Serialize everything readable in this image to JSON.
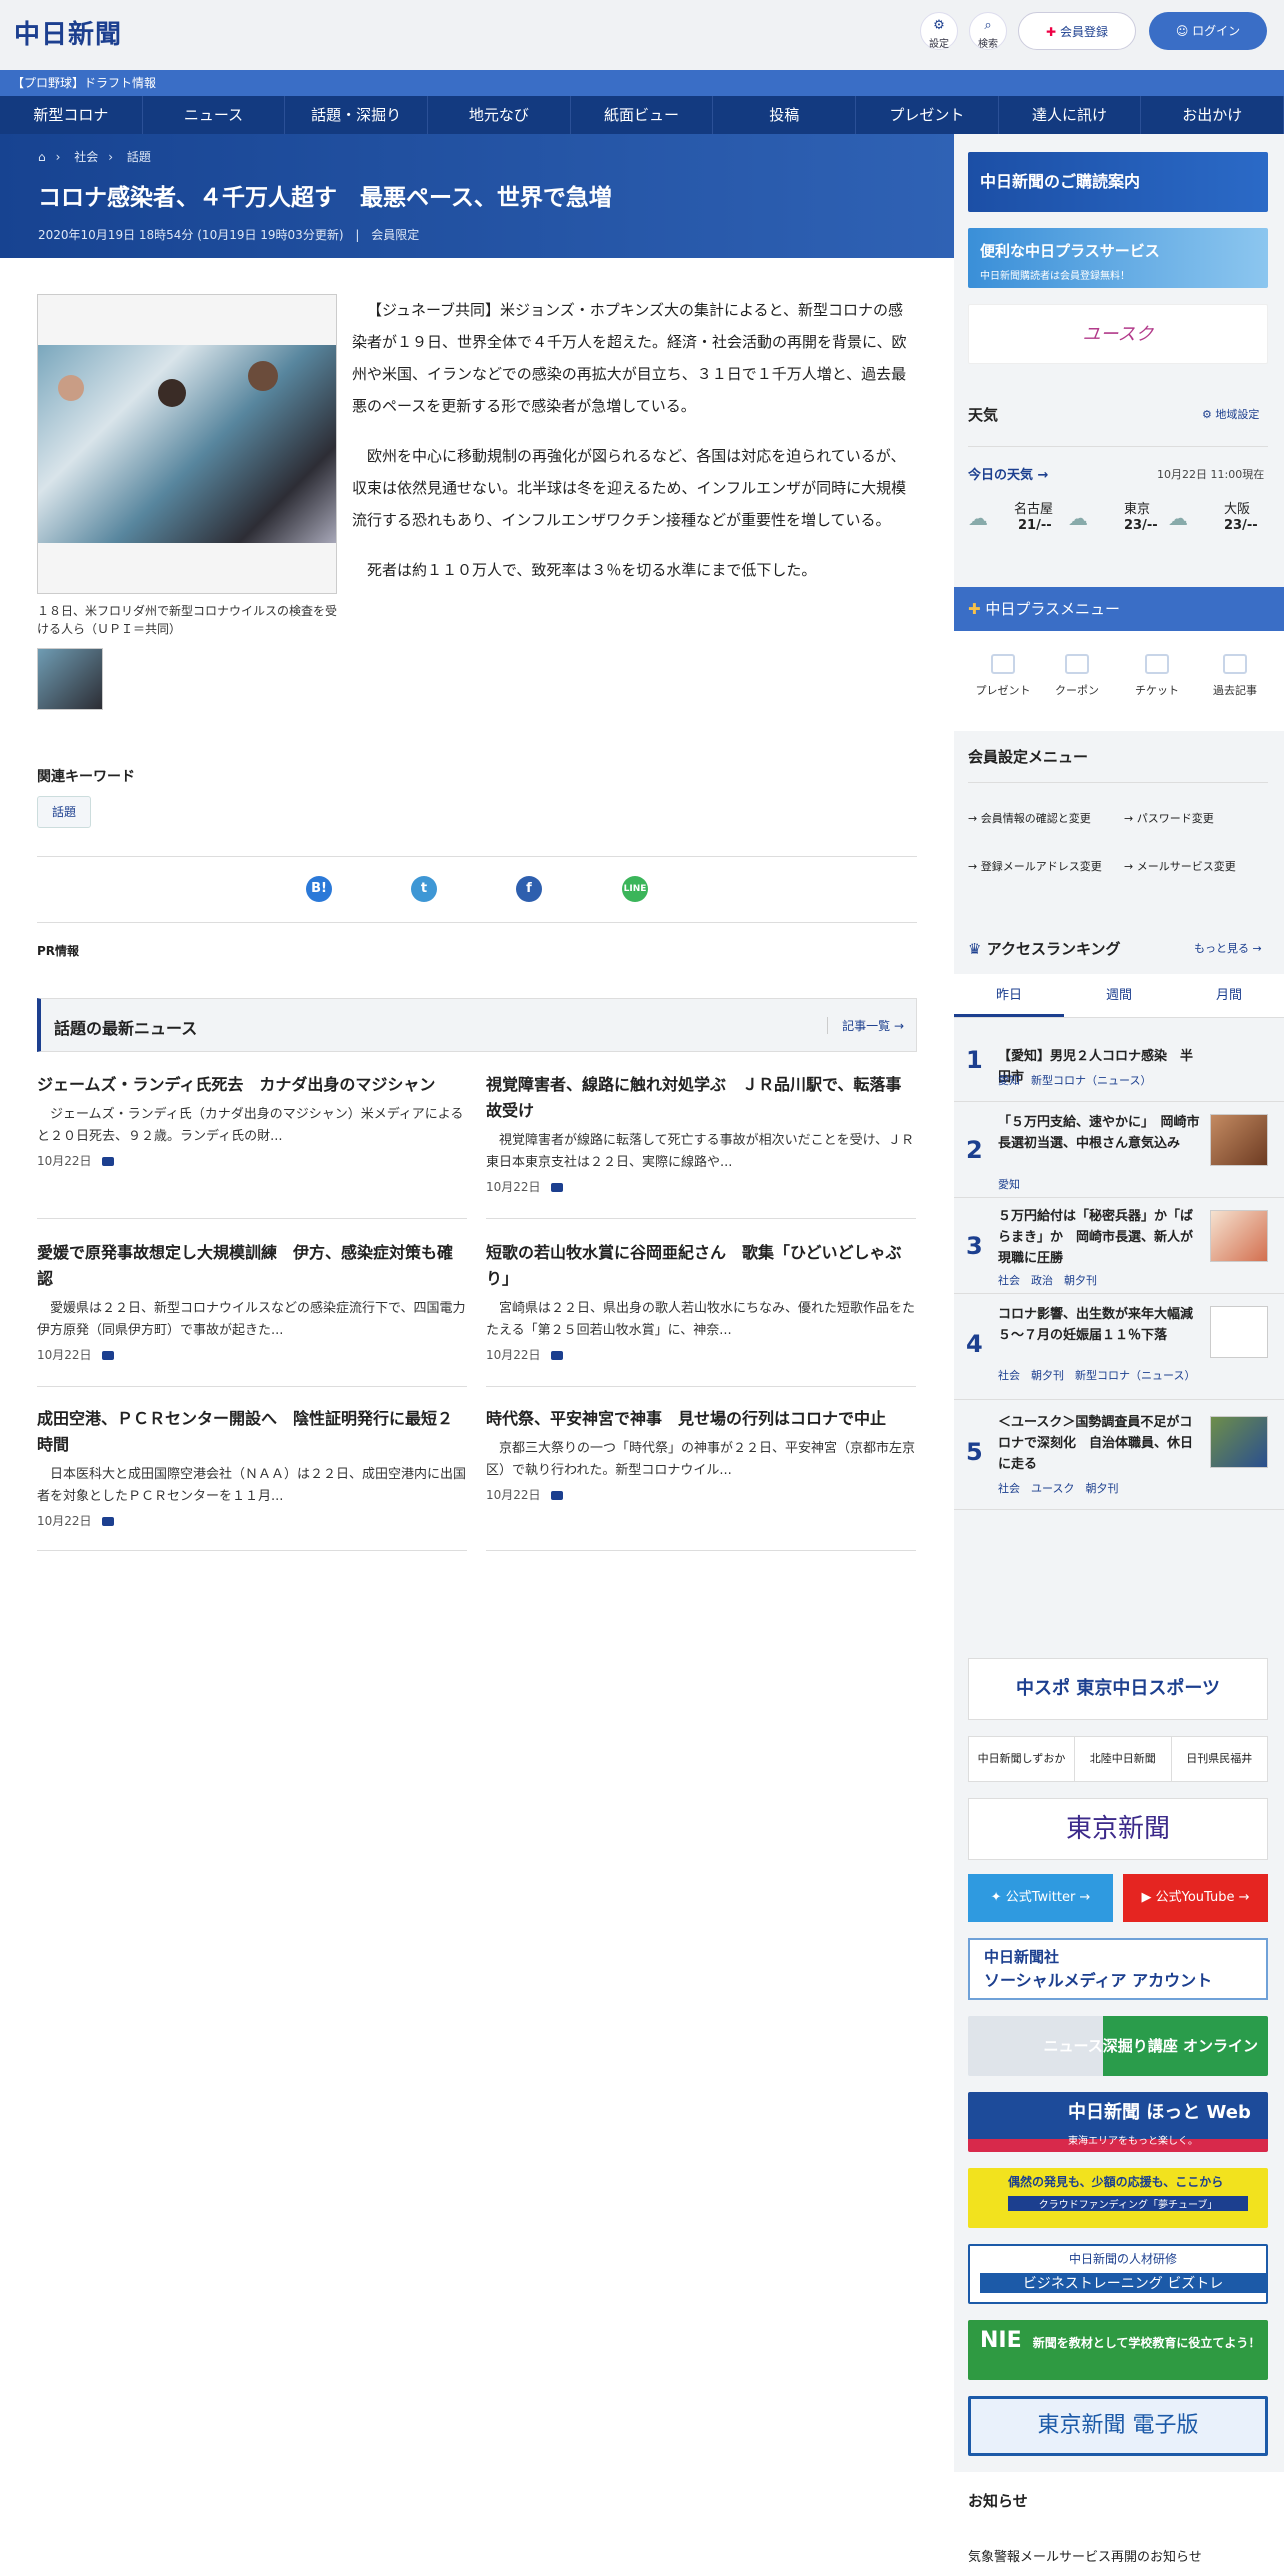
{
  "header": {
    "logo": "中日新聞",
    "settings_label": "設定",
    "search_label": "検索",
    "register_label": "会員登録",
    "login_label": "ログイン"
  },
  "draft_bar": "【プロ野球】ドラフト情報",
  "nav": [
    "新型コロナ",
    "ニュース",
    "話題・深掘り",
    "地元なび",
    "紙面ビュー",
    "投稿",
    "プレゼント",
    "達人に訊け",
    "お出かけ"
  ],
  "breadcrumb": [
    "社会",
    "話題"
  ],
  "article": {
    "title": "コロナ感染者、４千万人超す　最悪ペース、世界で急増",
    "meta": "2020年10月19日 18時54分 (10月19日 19時03分更新)",
    "member_only": "会員限定",
    "caption": "１８日、米フロリダ州で新型コロナウイルスの検査を受ける人ら（ＵＰＩ＝共同）",
    "paragraphs": [
      "【ジュネーブ共同】米ジョンズ・ホプキンズ大の集計によると、新型コロナの感染者が１９日、世界全体で４千万人を超えた。経済・社会活動の再開を背景に、欧州や米国、イランなどでの感染の再拡大が目立ち、３１日で１千万人増と、過去最悪のペースを更新する形で感染者が急増している。",
      "欧州を中心に移動規制の再強化が図られるなど、各国は対応を迫られているが、収束は依然見通せない。北半球は冬を迎えるため、インフルエンザが同時に大規模流行する恐れもあり、インフルエンザワクチン接種などが重要性を増している。",
      "死者は約１１０万人で、致死率は３％を切る水準にまで低下した。"
    ]
  },
  "keywords": {
    "heading": "関連キーワード",
    "items": [
      "話題"
    ]
  },
  "pr_label": "PR情報",
  "latest": {
    "heading": "話題の最新ニュース",
    "more": "記事一覧",
    "items": [
      {
        "title": "ジェームズ・ランディ氏死去　カナダ出身のマジシャン",
        "summary": "ジェームズ・ランディ氏（カナダ出身のマジシャン）米メディアによると２０日死去、９２歳。ランディ氏の財...",
        "date": "10月22日"
      },
      {
        "title": "視覚障害者、線路に触れ対処学ぶ　ＪＲ品川駅で、転落事故受け",
        "summary": "視覚障害者が線路に転落して死亡する事故が相次いだことを受け、ＪＲ東日本東京支社は２２日、実際に線路や...",
        "date": "10月22日"
      },
      {
        "title": "愛媛で原発事故想定し大規模訓練　伊方、感染症対策も確認",
        "summary": "愛媛県は２２日、新型コロナウイルスなどの感染症流行下で、四国電力伊方原発（同県伊方町）で事故が起きた...",
        "date": "10月22日"
      },
      {
        "title": "短歌の若山牧水賞に谷岡亜紀さん　歌集「ひどいどしゃぶり」",
        "summary": "宮崎県は２２日、県出身の歌人若山牧水にちなみ、優れた短歌作品をたたえる「第２５回若山牧水賞」に、神奈...",
        "date": "10月22日"
      },
      {
        "title": "成田空港、ＰＣＲセンター開設へ　陰性証明発行に最短２時間",
        "summary": "日本医科大と成田国際空港会社（ＮＡＡ）は２２日、成田空港内に出国者を対象としたＰＣＲセンターを１１月...",
        "date": "10月22日"
      },
      {
        "title": "時代祭、平安神宮で神事　見せ場の行列はコロナで中止",
        "summary": "京都三大祭りの一つ「時代祭」の神事が２２日、平安神宮（京都市左京区）で執り行われた。新型コロナウイル...",
        "date": "10月22日"
      }
    ]
  },
  "sidebar": {
    "banner1": "中日新聞のご購読案内",
    "banner2_title": "便利な中日プラスサービス",
    "banner2_sub": "中日新聞購読者は会員登録無料！",
    "banner3": "ユースク",
    "weather": {
      "heading": "天気",
      "region_label": "地域設定",
      "today": "今日の天気",
      "updated": "10月22日 11:00現在",
      "cities": [
        {
          "name": "名古屋",
          "temp": "21/--"
        },
        {
          "name": "東京",
          "temp": "23/--"
        },
        {
          "name": "大阪",
          "temp": "23/--"
        }
      ]
    },
    "plus_menu": {
      "heading": "中日プラスメニュー",
      "items": [
        "プレゼント",
        "クーポン",
        "チケット",
        "過去記事"
      ]
    },
    "member_menu": {
      "heading": "会員設定メニュー",
      "items": [
        "会員情報の確認と変更",
        "パスワード変更",
        "登録メールアドレス変更",
        "メールサービス変更"
      ]
    },
    "ranking": {
      "heading": "アクセスランキング",
      "more": "もっと見る",
      "tabs": [
        "昨日",
        "週間",
        "月間"
      ],
      "items": [
        {
          "rank": "1",
          "title": "【愛知】男児２人コロナ感染　半田市",
          "tags": "愛知　新型コロナ（ニュース）"
        },
        {
          "rank": "2",
          "title": "「５万円支給、速やかに」　岡崎市長選初当選、中根さん意気込み",
          "tags": "愛知"
        },
        {
          "rank": "3",
          "title": "５万円給付は「秘密兵器」か「ばらまき」か　岡崎市長選、新人が現職に圧勝",
          "tags": "社会　政治　朝夕刊"
        },
        {
          "rank": "4",
          "title": "コロナ影響、出生数が来年大幅減　５～７月の妊娠届１１％下落",
          "tags": "社会　朝夕刊　新型コロナ（ニュース）"
        },
        {
          "rank": "5",
          "title": "＜ユースク＞国勢調査員不足がコロナで深刻化　自治体職員、休日に走る",
          "tags": "社会　ユースク　朝夕刊"
        }
      ]
    },
    "chuspo": "中スポ 東京中日スポーツ",
    "links": [
      "中日新聞しずおか",
      "北陸中日新聞",
      "日刊県民福井"
    ],
    "tokyo": "東京新聞",
    "twitter": "公式Twitter",
    "youtube": "公式YouTube",
    "social_title": "中日新聞社",
    "social_sub": "ソーシャルメディア アカウント",
    "fukabori": "ニュース深掘り講座 オンライン",
    "hotto_title": "中日新聞 ほっと Web",
    "hotto_sub": "東海エリアをもっと楽しく。",
    "crowd_title": "偶然の発見も、少額の応援も、ここから",
    "crowd_sub": "クラウドファンディング「夢チューブ」",
    "bizutore_title": "中日新聞の人材研修",
    "bizutore_sub": "ビジネストレーニング ビズトレ",
    "nie_title": "NIE",
    "nie_sub": "新聞を教材として学校教育に役立てよう！",
    "tokyo_digital": "東京新聞 電子版",
    "notice_heading": "お知らせ",
    "notice_item": "気象警報メールサービス再開のお知らせ"
  }
}
